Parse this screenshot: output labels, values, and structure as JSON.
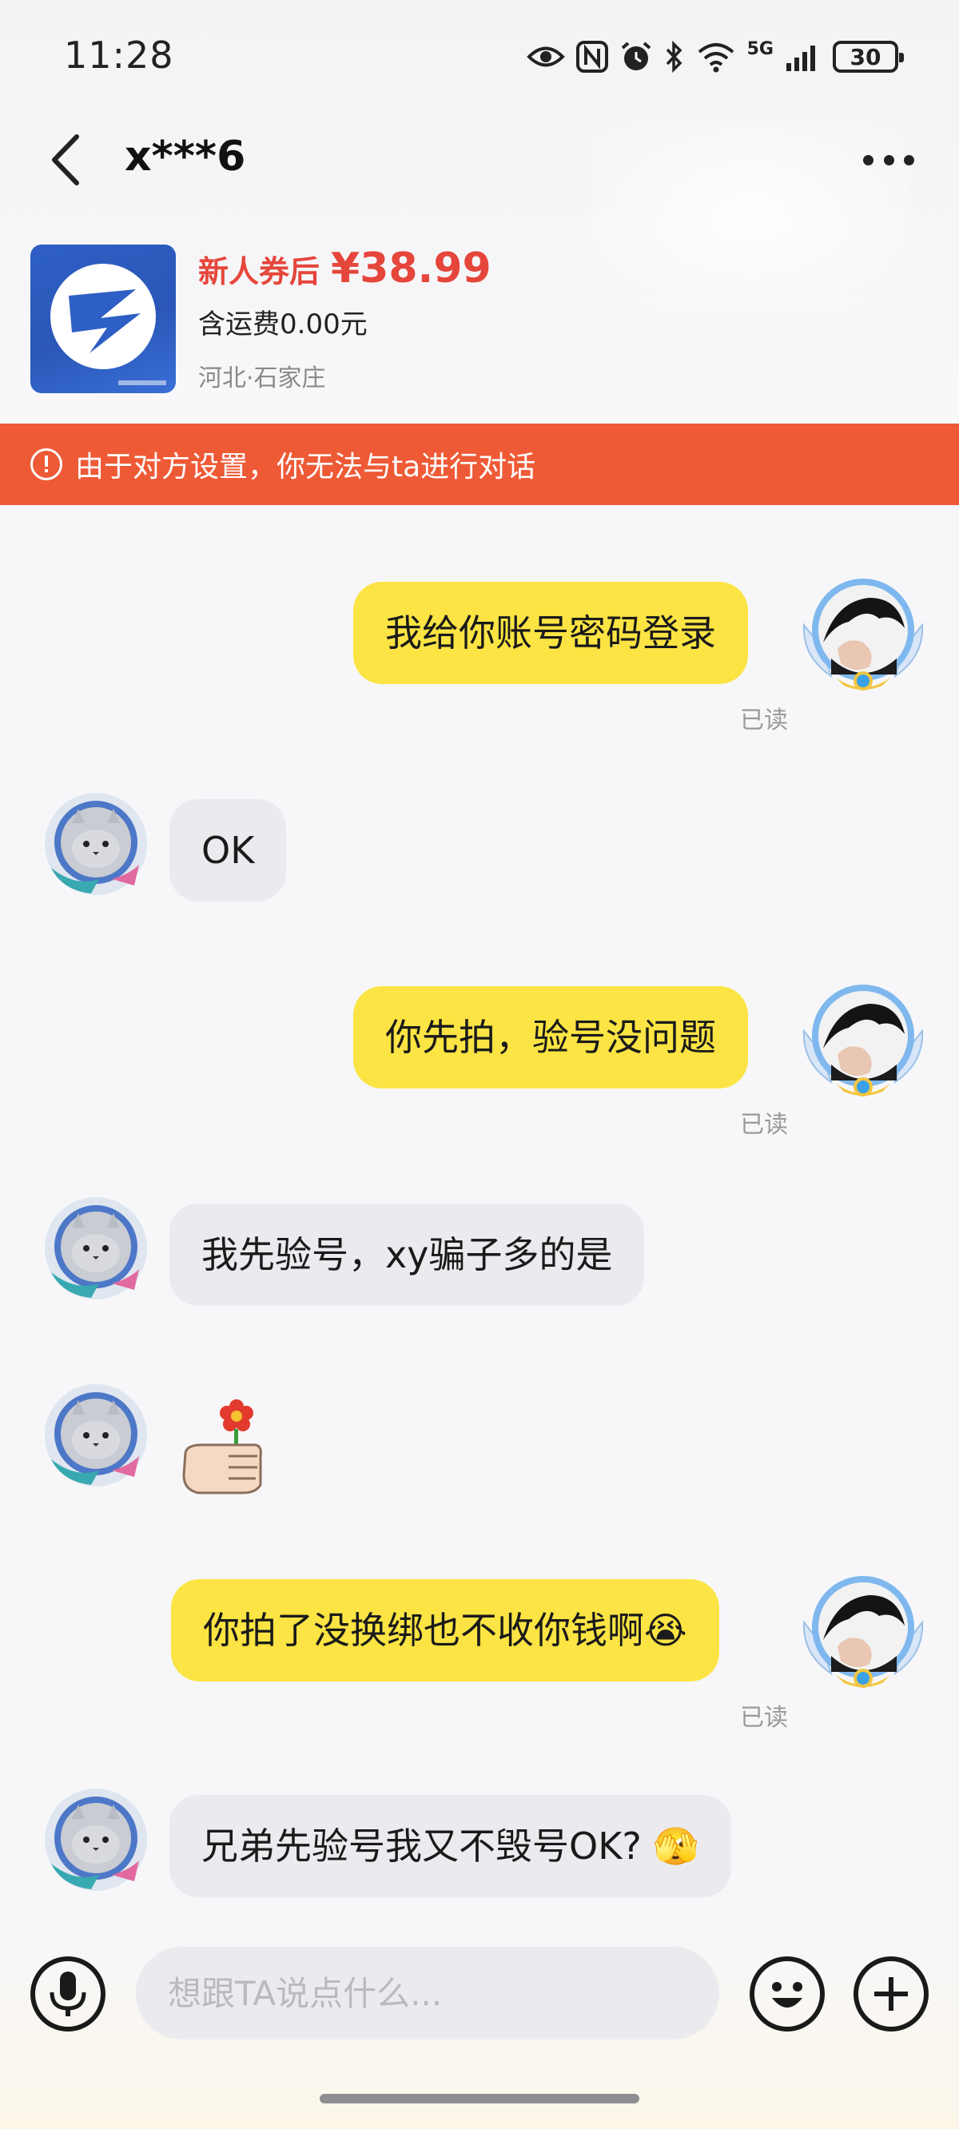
{
  "status_bar": {
    "time": "11:28",
    "network": "5G",
    "battery": "30",
    "icons": [
      "eye-icon",
      "nfc-icon",
      "alarm-icon",
      "bluetooth-icon",
      "wifi-icon",
      "signal-icon",
      "battery-icon"
    ]
  },
  "header": {
    "title": "x***6",
    "back_icon": "chevron-left-icon",
    "more_icon": "more-dots-icon"
  },
  "product": {
    "price_prefix": "新人券后",
    "price": "¥38.99",
    "shipping": "含运费0.00元",
    "location": "河北·石家庄"
  },
  "warning": {
    "text": "由于对方设置，你无法与ta进行对话",
    "color": "#ee5a36"
  },
  "messages": [
    {
      "sender": "me",
      "text": "我给你账号密码登录",
      "status": "已读"
    },
    {
      "sender": "them",
      "text": "OK"
    },
    {
      "sender": "me",
      "text": "你先拍，验号没问题",
      "status": "已读"
    },
    {
      "sender": "them",
      "text": "我先验号，xy骗子多的是"
    },
    {
      "sender": "them",
      "sticker": "flower-hand-icon"
    },
    {
      "sender": "me",
      "text": "你拍了没换绑也不收你钱啊😭",
      "status": "已读"
    },
    {
      "sender": "them",
      "text": "兄弟先验号我又不毁号OK? 🫣"
    }
  ],
  "input": {
    "placeholder": "想跟TA说点什么..."
  },
  "colors": {
    "my_bubble": "#fbe443",
    "their_bubble": "#ebebef",
    "price": "#e5463b"
  }
}
